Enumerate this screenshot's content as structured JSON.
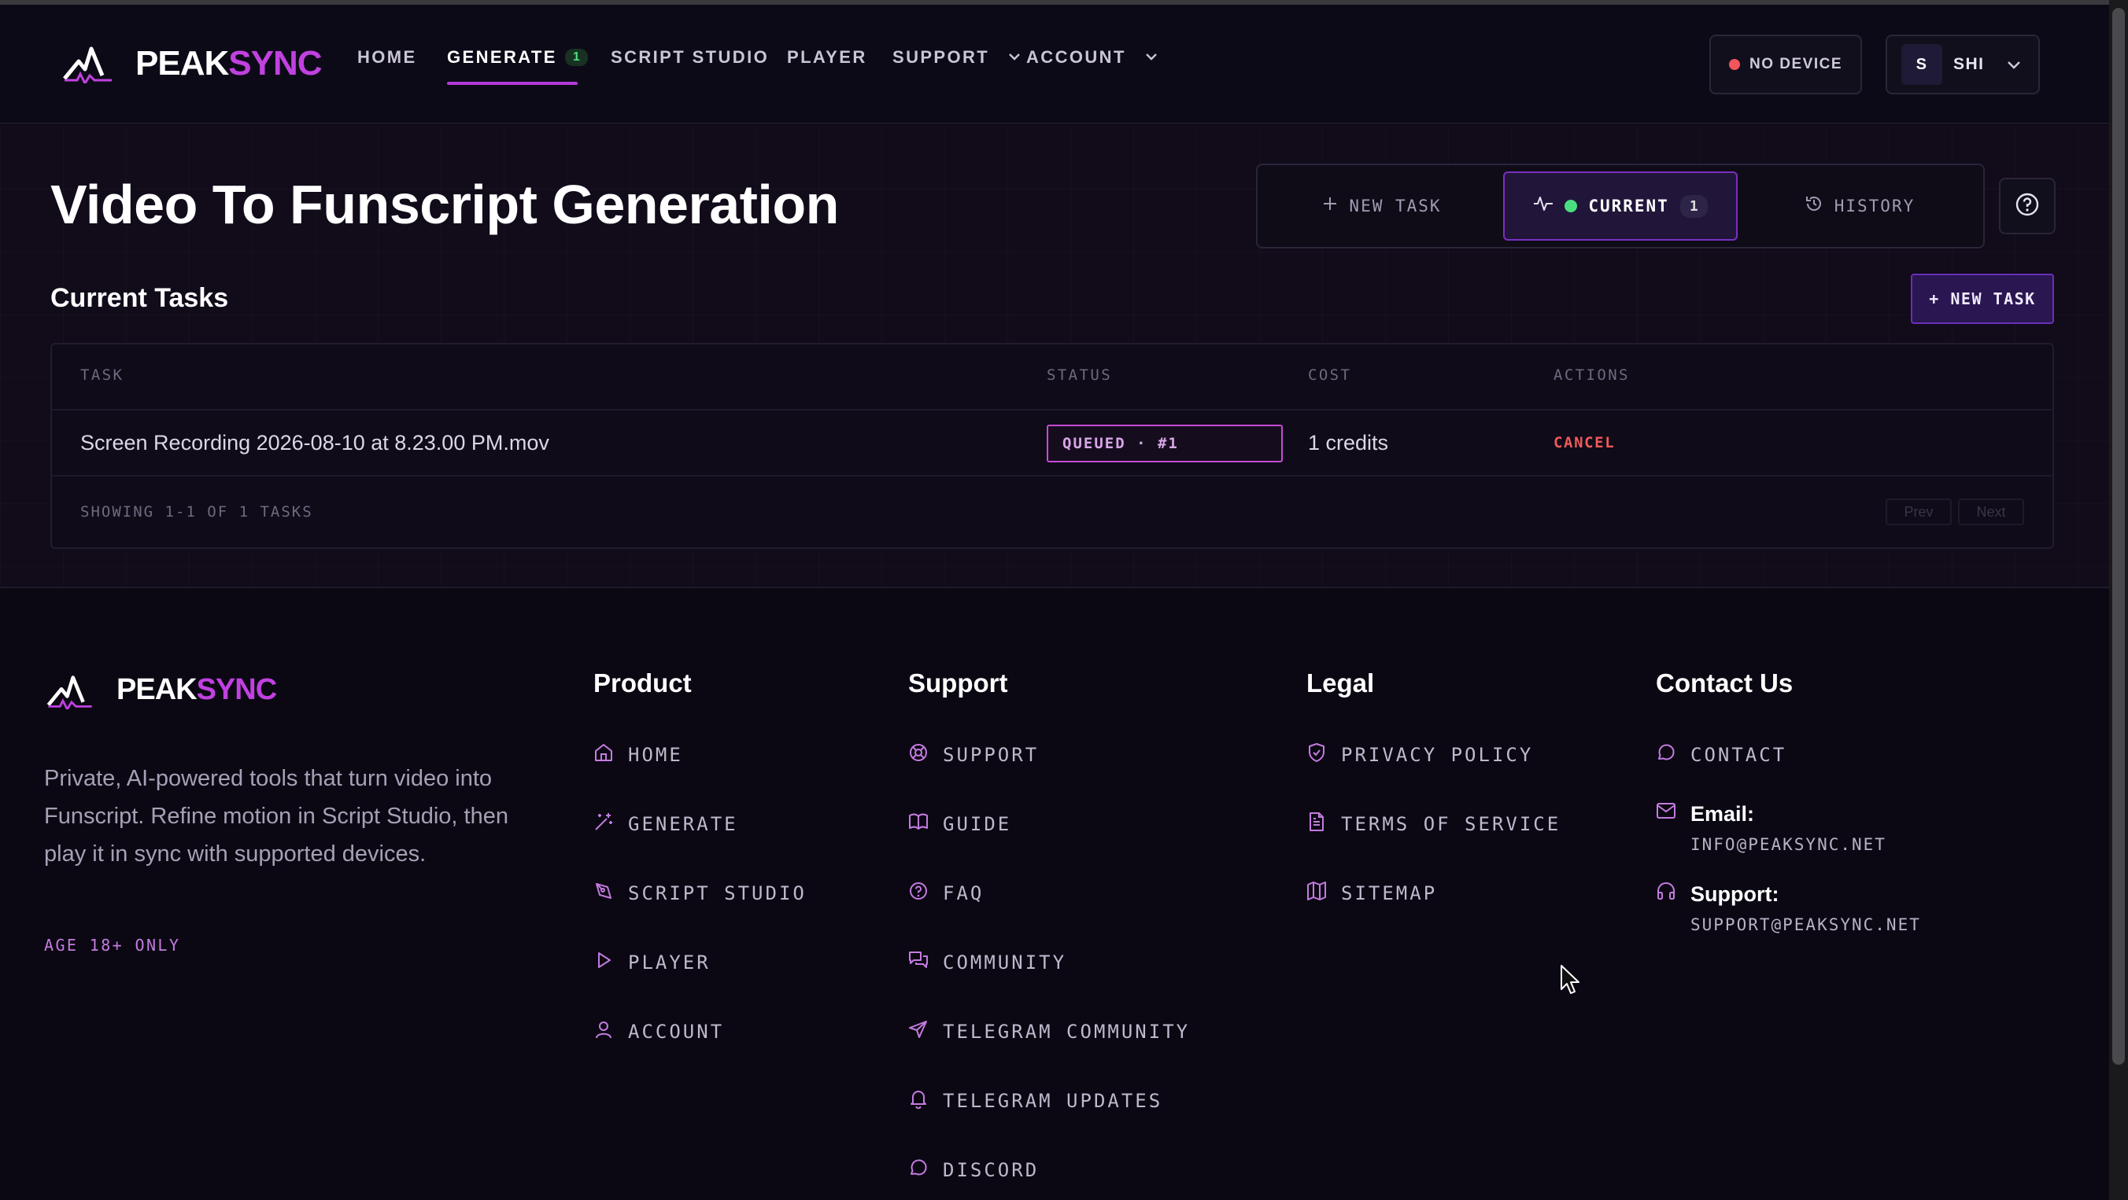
{
  "brand": {
    "name_left": "PEAK",
    "name_right": "SYNC",
    "accent_color": "#c041e0"
  },
  "nav": {
    "home": "HOME",
    "generate": "GENERATE",
    "generate_badge": "1",
    "script_studio": "SCRIPT STUDIO",
    "player": "PLAYER",
    "support": "SUPPORT",
    "account": "ACCOUNT"
  },
  "device": {
    "label": "NO DEVICE",
    "status_color": "#f2555a"
  },
  "user": {
    "initial": "S",
    "name": "SHI"
  },
  "page": {
    "title": "Video To Funscript Generation"
  },
  "tabs": {
    "new_task": "NEW TASK",
    "current": "CURRENT",
    "current_count": "1",
    "history": "HISTORY"
  },
  "section": {
    "title": "Current Tasks",
    "new_task_button": "+ NEW TASK"
  },
  "table": {
    "headers": [
      "TASK",
      "STATUS",
      "COST",
      "ACTIONS"
    ],
    "rows": [
      {
        "task": "Screen Recording 2026-08-10 at 8.23.00 PM.mov",
        "status": "QUEUED · #1",
        "cost": "1 credits",
        "action": "CANCEL"
      }
    ],
    "footer_info": "SHOWING 1-1 OF 1 TASKS",
    "prev": "Prev",
    "next": "Next"
  },
  "footer": {
    "description": "Private, AI-powered tools that turn video into Funscript. Refine motion in Script Studio, then play it in sync with supported devices.",
    "age_note": "AGE 18+ ONLY",
    "product": {
      "title": "Product",
      "links": [
        "HOME",
        "GENERATE",
        "SCRIPT STUDIO",
        "PLAYER",
        "ACCOUNT"
      ]
    },
    "support": {
      "title": "Support",
      "links": [
        "SUPPORT",
        "GUIDE",
        "FAQ",
        "COMMUNITY",
        "TELEGRAM COMMUNITY",
        "TELEGRAM UPDATES",
        "DISCORD"
      ]
    },
    "legal": {
      "title": "Legal",
      "links": [
        "PRIVACY POLICY",
        "TERMS OF SERVICE",
        "SITEMAP"
      ]
    },
    "contact": {
      "title": "Contact Us",
      "contact_link": "CONTACT",
      "email_label": "Email:",
      "email_value": "INFO@PEAKSYNC.NET",
      "support_label": "Support:",
      "support_value": "SUPPORT@PEAKSYNC.NET"
    }
  }
}
